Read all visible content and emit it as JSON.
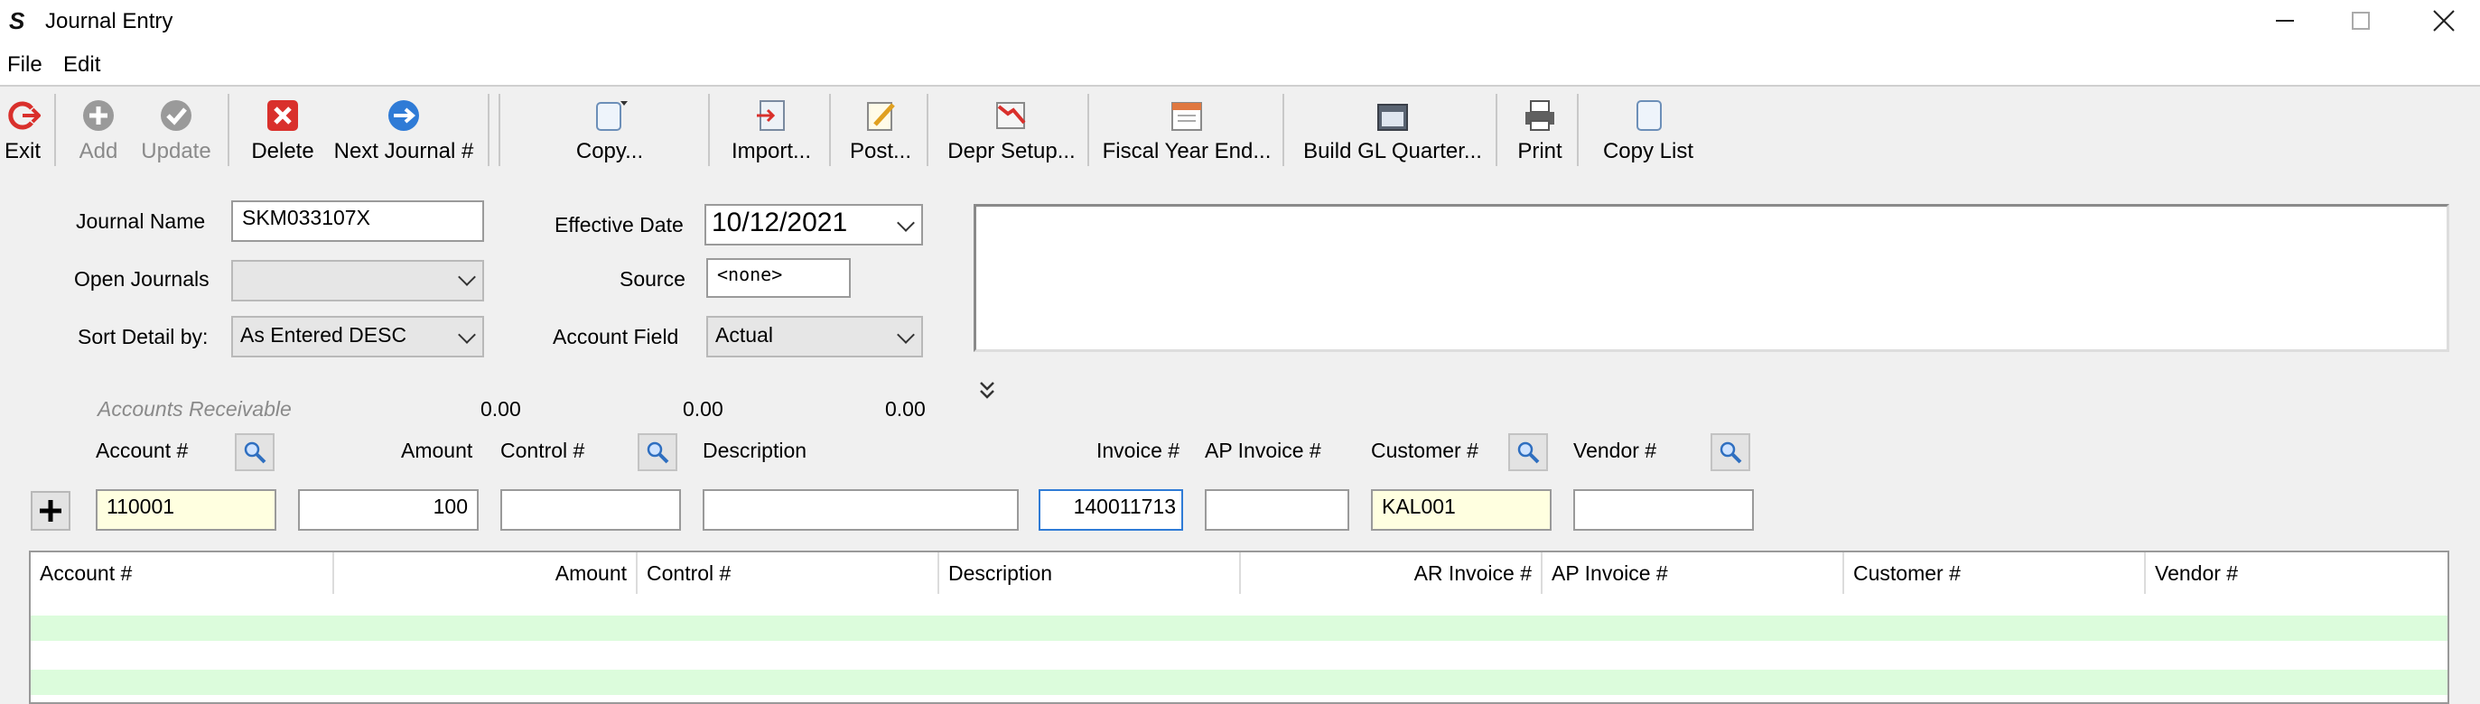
{
  "window": {
    "title": "Journal Entry"
  },
  "menu": {
    "file": "File",
    "edit": "Edit"
  },
  "toolbar": {
    "exit": "Exit",
    "add": "Add",
    "update": "Update",
    "delete": "Delete",
    "next_journal": "Next Journal #",
    "copy": "Copy...",
    "import": "Import...",
    "post": "Post...",
    "depr_setup": "Depr Setup...",
    "fiscal_year_end": "Fiscal Year End...",
    "build_gl_quarter": "Build GL Quarter...",
    "print": "Print",
    "copy_list": "Copy List"
  },
  "form": {
    "journal_name_label": "Journal Name",
    "journal_name": "SKM033107X",
    "open_journals_label": "Open Journals",
    "open_journals": "",
    "sort_detail_label": "Sort Detail by:",
    "sort_detail": "As Entered DESC",
    "effective_date_label": "Effective Date",
    "effective_date": "10/12/2021",
    "source_label": "Source",
    "source": "<none>",
    "account_field_label": "Account Field",
    "account_field": "Actual"
  },
  "totals": {
    "section": "Accounts Receivable",
    "t1": "0.00",
    "t2": "0.00",
    "t3": "0.00"
  },
  "entry": {
    "account_label": "Account #",
    "amount_label": "Amount",
    "control_label": "Control #",
    "description_label": "Description",
    "invoice_label": "Invoice #",
    "ap_invoice_label": "AP Invoice #",
    "customer_label": "Customer #",
    "vendor_label": "Vendor #",
    "account": "110001",
    "amount": "100",
    "control": "",
    "description": "",
    "invoice": "140011713",
    "ap_invoice": "",
    "customer": "KAL001",
    "vendor": ""
  },
  "grid": {
    "headers": {
      "account": "Account #",
      "amount": "Amount",
      "control": "Control #",
      "description": "Description",
      "ar_invoice": "AR Invoice #",
      "ap_invoice": "AP Invoice #",
      "customer": "Customer #",
      "vendor": "Vendor #"
    }
  },
  "colors": {
    "row_alt": "#dcfcdc",
    "accent_blue": "#2f7bd6",
    "delete_red": "#d9302c",
    "field_yellow": "#ffffe0"
  }
}
